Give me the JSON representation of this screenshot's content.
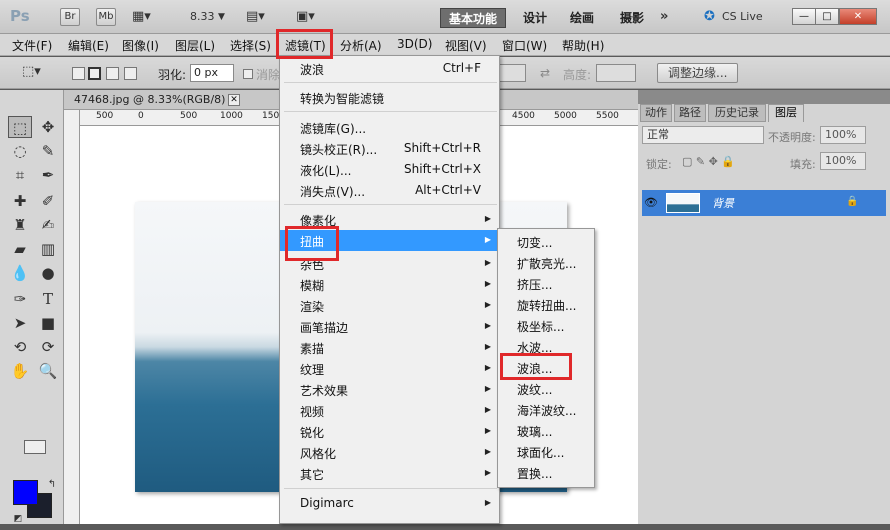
{
  "app": {
    "logo": "Ps",
    "br_label": "Br",
    "mb_label": "Mb",
    "zoom": "8.33",
    "workspaces": [
      "基本功能",
      "设计",
      "绘画",
      "摄影"
    ],
    "overflow": "»",
    "cslive": "CS Live",
    "win_min": "—",
    "win_max": "□",
    "win_close": "✕"
  },
  "menubar": {
    "items": [
      "文件(F)",
      "编辑(E)",
      "图像(I)",
      "图层(L)",
      "选择(S)",
      "滤镜(T)",
      "分析(A)",
      "3D(D)",
      "视图(V)",
      "窗口(W)",
      "帮助(H)"
    ]
  },
  "options": {
    "feather_label": "羽化:",
    "feather_value": "0 px",
    "antialias_label": "消除",
    "height_label": "高度:",
    "refine_button": "调整边缘..."
  },
  "document": {
    "tab_title": "47468.jpg @ 8.33%(RGB/8)",
    "tab_close": "✕",
    "ruler_labels": [
      "500",
      "0",
      "500",
      "1000",
      "1500",
      "4500",
      "5000",
      "5500"
    ]
  },
  "colors": {
    "foreground": "#0000ff",
    "background": "#1b1f2c",
    "highlight": "#3399ff",
    "annotation": "#e0282a"
  },
  "filter_menu": {
    "items": [
      {
        "label": "波浪",
        "shortcut": "Ctrl+F"
      },
      {
        "label": "转换为智能滤镜"
      },
      {
        "label": "滤镜库(G)..."
      },
      {
        "label": "镜头校正(R)...",
        "shortcut": "Shift+Ctrl+R"
      },
      {
        "label": "液化(L)...",
        "shortcut": "Shift+Ctrl+X"
      },
      {
        "label": "消失点(V)...",
        "shortcut": "Alt+Ctrl+V"
      },
      {
        "label": "像素化",
        "submenu": true
      },
      {
        "label": "扭曲",
        "submenu": true,
        "highlighted": true
      },
      {
        "label": "杂色",
        "submenu": true
      },
      {
        "label": "模糊",
        "submenu": true
      },
      {
        "label": "渲染",
        "submenu": true
      },
      {
        "label": "画笔描边",
        "submenu": true
      },
      {
        "label": "素描",
        "submenu": true
      },
      {
        "label": "纹理",
        "submenu": true
      },
      {
        "label": "艺术效果",
        "submenu": true
      },
      {
        "label": "视频",
        "submenu": true
      },
      {
        "label": "锐化",
        "submenu": true
      },
      {
        "label": "风格化",
        "submenu": true
      },
      {
        "label": "其它",
        "submenu": true
      },
      {
        "label": "Digimarc",
        "submenu": true
      }
    ]
  },
  "distort_menu": {
    "items": [
      "切变...",
      "扩散亮光...",
      "挤压...",
      "旋转扭曲...",
      "极坐标...",
      "水波...",
      "波浪...",
      "波纹...",
      "海洋波纹...",
      "玻璃...",
      "球面化...",
      "置换..."
    ]
  },
  "panels": {
    "tabs": [
      "动作",
      "路径",
      "历史记录",
      "图层"
    ],
    "blend_mode": "正常",
    "opacity_label": "不透明度:",
    "opacity_value": "100%",
    "lock_label": "锁定:",
    "fill_label": "填充:",
    "fill_value": "100%",
    "layer_name": "背景"
  },
  "icons": [
    "search-icon"
  ]
}
